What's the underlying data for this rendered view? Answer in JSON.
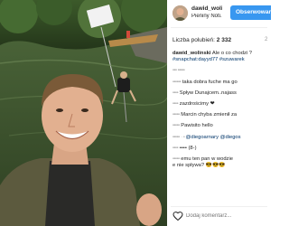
{
  "post": {
    "username": "dawid_wolinski",
    "username_short": "dawid_woli...",
    "location": "Pieniny Noti...",
    "follow_label": "Obserwowanie",
    "likes_label": "Liczba polubień:",
    "likes_count": "2 332",
    "time_ago": "2",
    "comment_placeholder": "Dodaj komentarz..."
  },
  "comments": [
    {
      "user": "dawid_wolinski",
      "text": "Ale o co chodzi ?",
      "extra": "#snapchat:dayyd77",
      "tag": "#szuwarek"
    },
    {
      "user": "••• •••••",
      "text": "",
      "extra": "",
      "tag": ""
    },
    {
      "user": "••••••",
      "text": "taka dobra fuche ma go",
      "extra": "",
      "tag": ""
    },
    {
      "user": "••••",
      "text": "Spływ Dunajcem..najass",
      "extra": "",
      "tag": ""
    },
    {
      "user": "••••",
      "text": "zazdrościmy ❤",
      "extra": "",
      "tag": ""
    },
    {
      "user": "•••••",
      "text": "Marcin chyba zmienił za",
      "extra": "",
      "tag": ""
    },
    {
      "user": "•••••",
      "text": "Pawisito hello",
      "extra": "",
      "tag": ""
    },
    {
      "user": "•••••",
      "text": "· • ",
      "extra": "",
      "tag": "@diegoarnary @diegos"
    },
    {
      "user": "••••",
      "text": "•••• (8-)",
      "extra": "",
      "tag": ""
    },
    {
      "user": "•••••",
      "text": "emu ten pan w wodzie",
      "extra": "e nie spływa? 😎😎😎",
      "tag": ""
    }
  ],
  "icons": {
    "heart": "heart-icon",
    "avatar": "avatar"
  },
  "colors": {
    "follow_button": "#3897f0",
    "hashtag": "#003569"
  }
}
